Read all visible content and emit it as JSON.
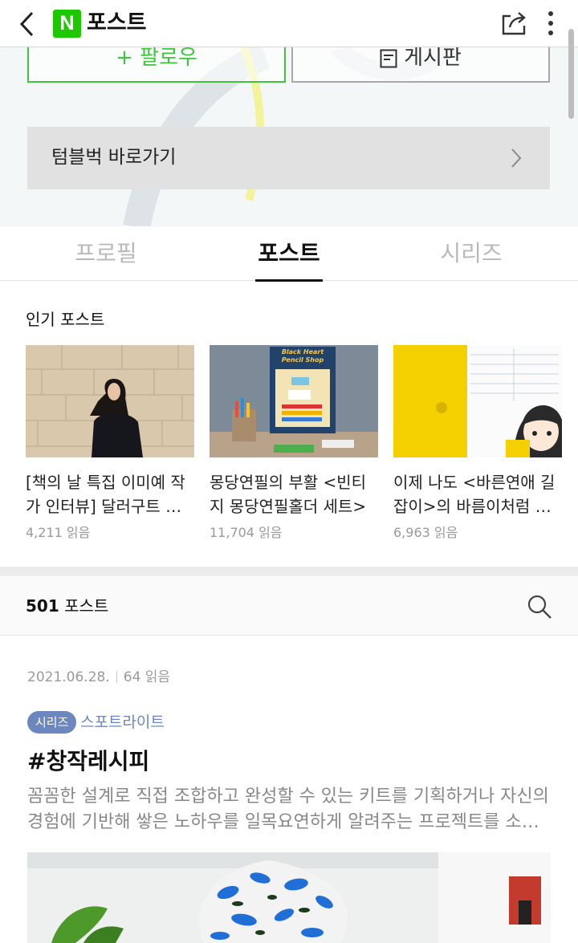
{
  "appbar": {
    "logo_letter": "N",
    "title": "포스트",
    "back_icon": "chevron-left-icon",
    "share_icon": "share-icon",
    "more_icon": "more-vertical-icon"
  },
  "hero": {
    "follow_label": "+ 팔로우",
    "board_label": "게시판",
    "board_icon": "board-icon",
    "tumblbug_label": "텀블벅 바로가기",
    "tumblbug_arrow_icon": "chevron-right-icon"
  },
  "tabs": [
    {
      "label": "프로필",
      "active": false
    },
    {
      "label": "포스트",
      "active": true
    },
    {
      "label": "시리즈",
      "active": false
    }
  ],
  "popular": {
    "title": "인기 포스트",
    "cards": [
      {
        "title": "[책의 날 특집 이미예 작가 인터뷰] 달러구트 꿈 백화점",
        "reads": "4,211 읽음"
      },
      {
        "title": "몽당연필의 부활 <빈티지 몽당연필홀더 세트>",
        "reads": "11,704 읽음"
      },
      {
        "title": "이제 나도 <바른연애 길잡이>의 바름이처럼 다이어리 꾸미기",
        "reads": "6,963 읽음"
      }
    ],
    "card2_sign": "Black Heart Pencil Shop"
  },
  "list": {
    "count": "501",
    "count_label": " 포스트",
    "search_icon": "search-icon"
  },
  "post": {
    "date": "2021.06.28.",
    "reads": "64 읽음",
    "series_badge": "시리즈",
    "series_name": "스포트라이트",
    "title": "#창작레시피",
    "desc": "꼼꼼한 설계로 직접 조합하고 완성할 수 있는 키트를 기획하거나 자신의 경험에 기반해 쌓은 노하우를 일목요연하게 알려주는 프로젝트를 소개합니다."
  },
  "colors": {
    "naver_green": "#1ec800",
    "follow_green": "#42c33f",
    "series_blue": "#6c87bd"
  }
}
